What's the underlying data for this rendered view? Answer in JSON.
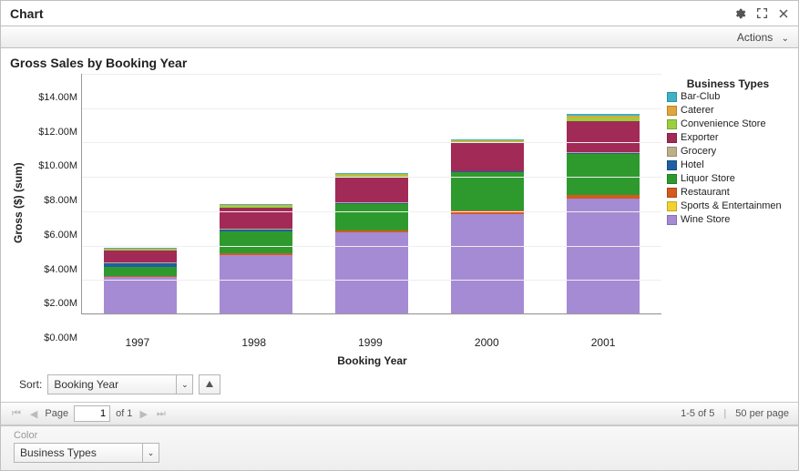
{
  "header": {
    "title": "Chart"
  },
  "actions": {
    "label": "Actions"
  },
  "chart": {
    "title": "Gross Sales by Booking Year",
    "xlabel": "Booking Year",
    "ylabel": "Gross ($) (sum)",
    "legend_title": "Business Types"
  },
  "sort": {
    "label": "Sort:",
    "value": "Booking Year"
  },
  "pager": {
    "page_label": "Page",
    "page_value": "1",
    "of_label": "of 1",
    "range": "1-5 of 5",
    "per_page": "50 per page"
  },
  "color": {
    "label": "Color",
    "value": "Business Types"
  },
  "chart_data": {
    "type": "bar",
    "stacked": true,
    "categories": [
      "1997",
      "1998",
      "1999",
      "2000",
      "2001"
    ],
    "ylim": [
      0,
      14
    ],
    "yticks": [
      "$0.00M",
      "$2.00M",
      "$4.00M",
      "$6.00M",
      "$8.00M",
      "$10.00M",
      "$12.00M",
      "$14.00M"
    ],
    "xlabel": "Booking Year",
    "ylabel": "Gross ($) (sum)",
    "series": [
      {
        "name": "Bar-Club",
        "color": "#3db3c4",
        "values": [
          0.05,
          0.05,
          0.05,
          0.05,
          0.1
        ]
      },
      {
        "name": "Caterer",
        "color": "#e0a63c",
        "values": [
          0.05,
          0.05,
          0.05,
          0.05,
          0.1
        ]
      },
      {
        "name": "Convenience Store",
        "color": "#9ccf3d",
        "values": [
          0.05,
          0.1,
          0.1,
          0.15,
          0.2
        ]
      },
      {
        "name": "Exporter",
        "color": "#a22a57",
        "values": [
          0.7,
          1.2,
          1.5,
          1.6,
          1.8
        ]
      },
      {
        "name": "Grocery",
        "color": "#bfae8a",
        "values": [
          0.05,
          0.05,
          0.05,
          0.05,
          0.05
        ]
      },
      {
        "name": "Hotel",
        "color": "#1e5fa3",
        "values": [
          0.2,
          0.1,
          0.05,
          0.05,
          0.05
        ]
      },
      {
        "name": "Liquor Store",
        "color": "#2e9a2e",
        "values": [
          0.5,
          1.3,
          1.5,
          2.2,
          2.4
        ]
      },
      {
        "name": "Restaurant",
        "color": "#d45a1e",
        "values": [
          0.1,
          0.1,
          0.15,
          0.2,
          0.2
        ]
      },
      {
        "name": "Sports & Entertainmen",
        "color": "#f2d22e",
        "values": [
          0.0,
          0.0,
          0.0,
          0.0,
          0.0
        ]
      },
      {
        "name": "Wine Store",
        "color": "#a58bd3",
        "values": [
          2.1,
          3.4,
          4.7,
          5.8,
          6.7
        ]
      }
    ],
    "totals": [
      3.8,
      6.35,
      8.15,
      10.15,
      11.6
    ]
  }
}
